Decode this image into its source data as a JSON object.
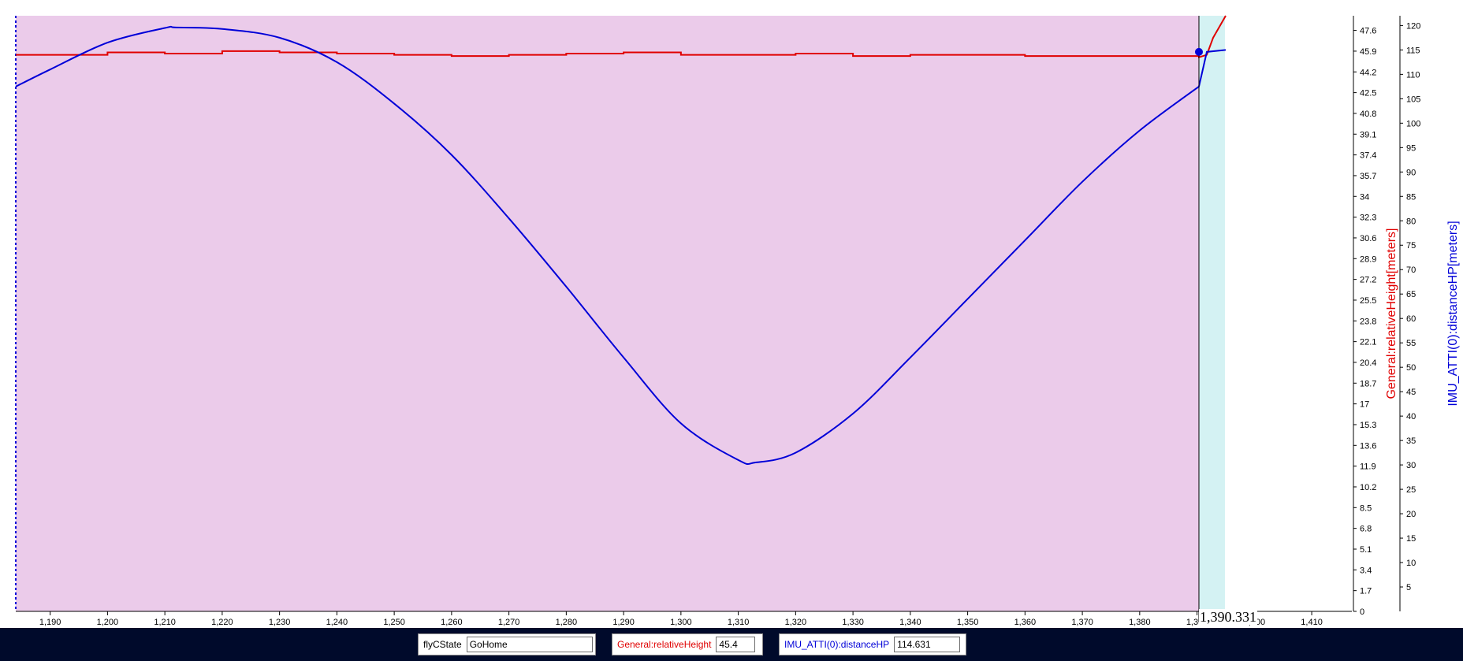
{
  "chart_data": {
    "type": "line",
    "x": [
      1184,
      1190,
      1200,
      1210,
      1212,
      1220,
      1230,
      1240,
      1250,
      1260,
      1270,
      1280,
      1290,
      1300,
      1310,
      1313,
      1320,
      1330,
      1340,
      1350,
      1360,
      1370,
      1380,
      1390.33
    ],
    "xlim": [
      1184,
      1417
    ],
    "x_ticks": [
      1190,
      1200,
      1210,
      1220,
      1230,
      1240,
      1250,
      1260,
      1270,
      1280,
      1290,
      1300,
      1310,
      1320,
      1330,
      1340,
      1350,
      1360,
      1370,
      1380,
      1390,
      1400,
      1410
    ],
    "series": [
      {
        "name": "General:relativeHeight",
        "axis": "right-inner",
        "color": "#e00000",
        "x": [
          1184,
          1200,
          1210,
          1220,
          1230,
          1240,
          1250,
          1260,
          1270,
          1280,
          1290,
          1300,
          1310,
          1320,
          1330,
          1340,
          1350,
          1360,
          1370,
          1380,
          1390.33
        ],
        "values": [
          45.6,
          45.8,
          45.7,
          45.9,
          45.8,
          45.7,
          45.6,
          45.5,
          45.6,
          45.7,
          45.8,
          45.6,
          45.6,
          45.7,
          45.5,
          45.6,
          45.6,
          45.5,
          45.5,
          45.5,
          45.4
        ]
      },
      {
        "name": "IMU_ATTI(0):distanceHP",
        "axis": "right-outer",
        "color": "#0000d8",
        "values": [
          107.5,
          111,
          116.5,
          119.5,
          119.6,
          119.3,
          117.5,
          112.5,
          104,
          93.5,
          80.5,
          66.5,
          52,
          38.5,
          31,
          30.5,
          32.5,
          40.5,
          52,
          64,
          76,
          88,
          98.5,
          107.5,
          114.6
        ]
      }
    ],
    "y_left_inner": {
      "label": "General:relativeHeight[meters]",
      "ticks": [
        "0",
        "1.7",
        "3.4",
        "5.1",
        "6.8",
        "8.5",
        "10.2",
        "11.9",
        "13.6",
        "15.3",
        "17",
        "18.7",
        "20.4",
        "22.1",
        "23.8",
        "25.5",
        "27.2",
        "28.9",
        "30.6",
        "32.3",
        "34",
        "35.7",
        "37.4",
        "39.1",
        "40.8",
        "42.5",
        "44.2",
        "45.9",
        "47.6"
      ],
      "ylim": [
        0,
        48.8
      ]
    },
    "y_right_outer": {
      "label": "IMU_ATTI(0):distanceHP[meters]",
      "ticks": [
        "5",
        "10",
        "15",
        "20",
        "25",
        "30",
        "35",
        "40",
        "45",
        "50",
        "55",
        "60",
        "65",
        "70",
        "75",
        "80",
        "85",
        "90",
        "95",
        "100",
        "105",
        "110",
        "115",
        "120"
      ],
      "ylim": [
        0,
        122
      ]
    },
    "shaded_regions": [
      {
        "state": "GoHome",
        "from": 1184,
        "to": 1390.33,
        "color": "#ebcbea"
      },
      {
        "state": "",
        "from": 1390.33,
        "to": 1395,
        "color": "#d4f2f3"
      }
    ],
    "cursor": {
      "x": 1390.331,
      "label": "1,390.331"
    }
  },
  "status": {
    "fly_c_state": {
      "label": "flyCState",
      "value": "GoHome"
    },
    "relative_height": {
      "label": "General:relativeHeight",
      "value": "45.4",
      "color": "#e00000"
    },
    "distance_hp": {
      "label": "IMU_ATTI(0):distanceHP",
      "value": "114.631",
      "color": "#0000d8"
    }
  }
}
